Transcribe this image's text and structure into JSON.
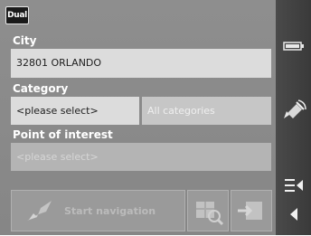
{
  "logo_text": "Dual",
  "form": {
    "city": {
      "label": "City",
      "value": "32801 ORLANDO"
    },
    "category": {
      "label": "Category",
      "select_value": "<please select>",
      "secondary_value": "All categories"
    },
    "poi": {
      "label": "Point of interest",
      "placeholder": "<please select>"
    }
  },
  "buttons": {
    "start_navigation": "Start navigation"
  },
  "sidebar_icons": [
    "battery-icon",
    "gps-signal-icon",
    "menu-icon",
    "back-arrow-icon"
  ]
}
